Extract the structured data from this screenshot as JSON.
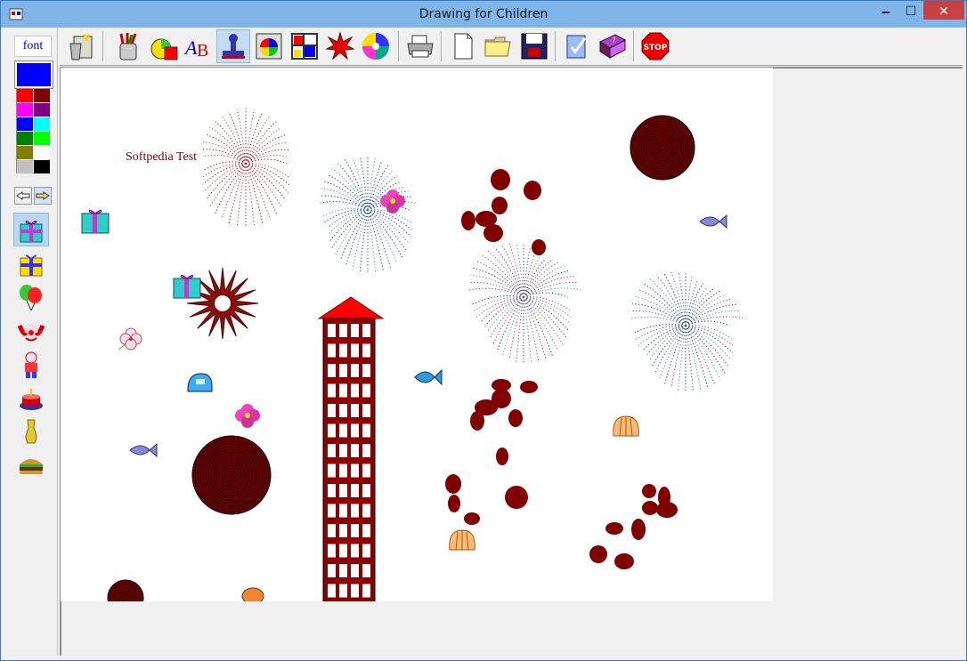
{
  "window": {
    "title": "Drawing for Children",
    "min_glyph": "🗕",
    "max_glyph": "☐",
    "close_glyph": "✕"
  },
  "left_panel": {
    "font_label": "font",
    "current_color": "#0000ff",
    "palette": [
      "#ff0000",
      "#800000",
      "#ff00ff",
      "#800080",
      "#0000ff",
      "#00ffff",
      "#008000",
      "#00ff00",
      "#808000",
      "#ffffff",
      "#c0c0c0",
      "#000000"
    ],
    "stamps": [
      "gift-box-icon",
      "gift-box-yellow-icon",
      "balloons-icon",
      "clown-icon",
      "clown-full-icon",
      "cake-icon",
      "trumpet-icon",
      "burger-icon"
    ]
  },
  "toolbar": {
    "tools": [
      "clear-canvas-icon",
      "pencil-cup-icon",
      "shapes-icon",
      "text-tool-icon",
      "stamp-tool-icon",
      "color-wheel-icon",
      "rectangles-icon",
      "burst-icon",
      "swirl-icon",
      "printer-icon",
      "new-file-icon",
      "open-folder-icon",
      "save-disk-icon",
      "check-doc-icon",
      "help-book-icon",
      "stop-icon"
    ],
    "stop_label": "STOP"
  },
  "canvas": {
    "text": "Softpedia Test",
    "text_color": "#800000",
    "building_color": "#8b0000",
    "roof_color": "#ff0000"
  }
}
